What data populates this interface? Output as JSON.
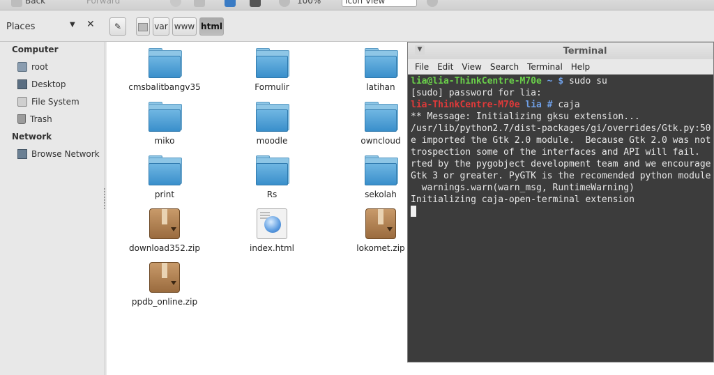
{
  "toolbar": {
    "back_label": "Back",
    "forward_label": "Forward",
    "zoom_label": "100%",
    "view_mode": "Icon View"
  },
  "placesbar": {
    "title": "Places",
    "path": [
      "var",
      "www",
      "html"
    ]
  },
  "sidebar": {
    "sections": [
      {
        "title": "Computer",
        "items": [
          {
            "label": "root",
            "icon": "home-folder-icon"
          },
          {
            "label": "Desktop",
            "icon": "desktop-icon"
          },
          {
            "label": "File System",
            "icon": "drive-icon"
          },
          {
            "label": "Trash",
            "icon": "trash-icon"
          }
        ]
      },
      {
        "title": "Network",
        "items": [
          {
            "label": "Browse Network",
            "icon": "network-icon"
          }
        ]
      }
    ]
  },
  "files": [
    {
      "name": "cmsbalitbangv35",
      "type": "folder"
    },
    {
      "name": "Formulir",
      "type": "folder"
    },
    {
      "name": "latihan",
      "type": "folder"
    },
    {
      "name": "miko",
      "type": "folder"
    },
    {
      "name": "moodle",
      "type": "folder"
    },
    {
      "name": "owncloud",
      "type": "folder"
    },
    {
      "name": "print",
      "type": "folder"
    },
    {
      "name": "Rs",
      "type": "folder"
    },
    {
      "name": "sekolah",
      "type": "folder"
    },
    {
      "name": "download352.zip",
      "type": "zip"
    },
    {
      "name": "index.html",
      "type": "html"
    },
    {
      "name": "lokomet.zip",
      "type": "zip"
    },
    {
      "name": "ppdb_online.zip",
      "type": "zip"
    }
  ],
  "terminal": {
    "title": "Terminal",
    "menu": [
      "File",
      "Edit",
      "View",
      "Search",
      "Terminal",
      "Help"
    ],
    "lines": {
      "l1_user": "lia@lia-ThinkCentre-M70e",
      "l1_path": " ~ $",
      "l1_cmd": " sudo su",
      "l2": "[sudo] password for lia:",
      "l3_host": "lia-ThinkCentre-M70e",
      "l3_path": " lia #",
      "l3_cmd": " caja",
      "l4": "** Message: Initializing gksu extension...",
      "l5": "/usr/lib/python2.7/dist-packages/gi/overrides/Gtk.py:50",
      "l6": "e imported the Gtk 2.0 module.  Because Gtk 2.0 was not",
      "l7": "trospection some of the interfaces and API will fail.",
      "l8": "rted by the pygobject development team and we encourage",
      "l9": "Gtk 3 or greater. PyGTK is the recomended python module",
      "l10": "  warnings.warn(warn_msg, RuntimeWarning)",
      "l11": "Initializing caja-open-terminal extension"
    }
  }
}
